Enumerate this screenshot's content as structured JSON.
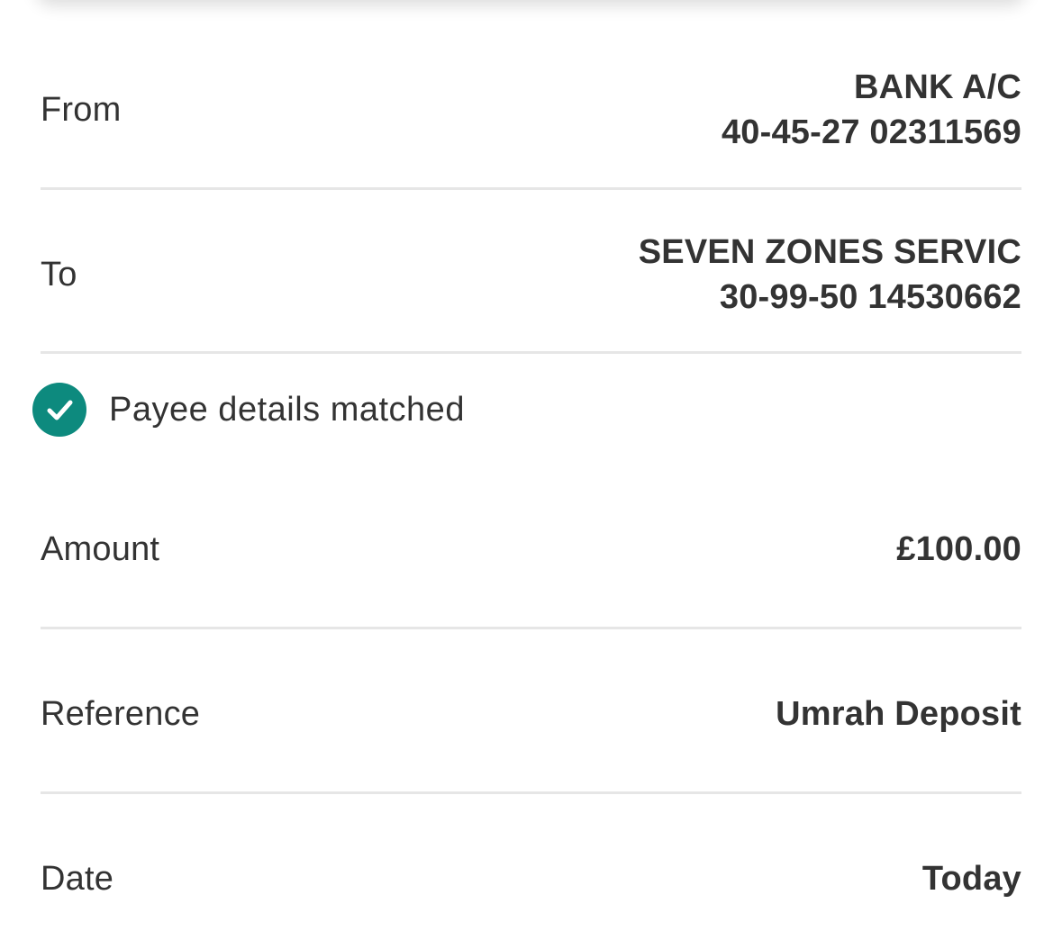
{
  "payment": {
    "from": {
      "label": "From",
      "account_name": "BANK A/C",
      "account_details": "40-45-27 02311569"
    },
    "to": {
      "label": "To",
      "payee_name": "SEVEN ZONES SERVIC",
      "payee_details": "30-99-50 14530662"
    },
    "payee_match": {
      "icon": "check-circle-icon",
      "text": "Payee details matched",
      "color": "#0d8a7e"
    },
    "amount": {
      "label": "Amount",
      "value": "£100.00"
    },
    "reference": {
      "label": "Reference",
      "value": "Umrah Deposit"
    },
    "date": {
      "label": "Date",
      "value": "Today"
    }
  },
  "colors": {
    "text": "#333333",
    "divider": "#e6e6e6",
    "accent": "#0d8a7e"
  }
}
